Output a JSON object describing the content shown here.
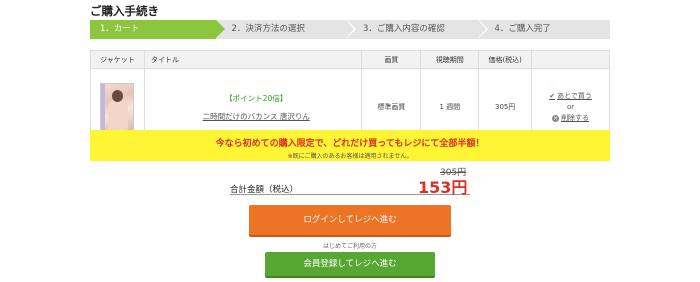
{
  "page_title": "ご購入手続き",
  "steps": [
    {
      "label": "1．カート",
      "active": true
    },
    {
      "label": "2．決済方法の選択",
      "active": false
    },
    {
      "label": "3．ご購入内容の確認",
      "active": false
    },
    {
      "label": "4．ご購入完了",
      "active": false
    }
  ],
  "table": {
    "headers": [
      "ジャケット",
      "タイトル",
      "画質",
      "視聴期間",
      "価格(税込)",
      ""
    ],
    "rows": [
      {
        "point_label": "【ポイント20倍】",
        "title": "二時間だけのバカンス 唐沢りん",
        "quality": "標準画質",
        "period": "1 週間",
        "price": "305円",
        "buy_later": "あとで買う",
        "or": "or",
        "delete": "削除する"
      }
    ]
  },
  "banner": {
    "main": "今なら初めての購入限定で、どれだけ買ってもレジにて全部半額！",
    "sub": "※既にご購入のあるお客様は適用されません。"
  },
  "total": {
    "label": "合計金額（税込）",
    "old_price": "305円",
    "new_price": "153円"
  },
  "login_button": "ログインしてレジへ進む",
  "first_time": "はじめてご利用の方",
  "register_button": "会員登録してレジへ進む",
  "colors": {
    "step_active": "#8cc63f",
    "banner_bg": "#fff534",
    "accent_red": "#d9302a",
    "login_orange": "#ed7426",
    "register_green": "#57a832"
  }
}
